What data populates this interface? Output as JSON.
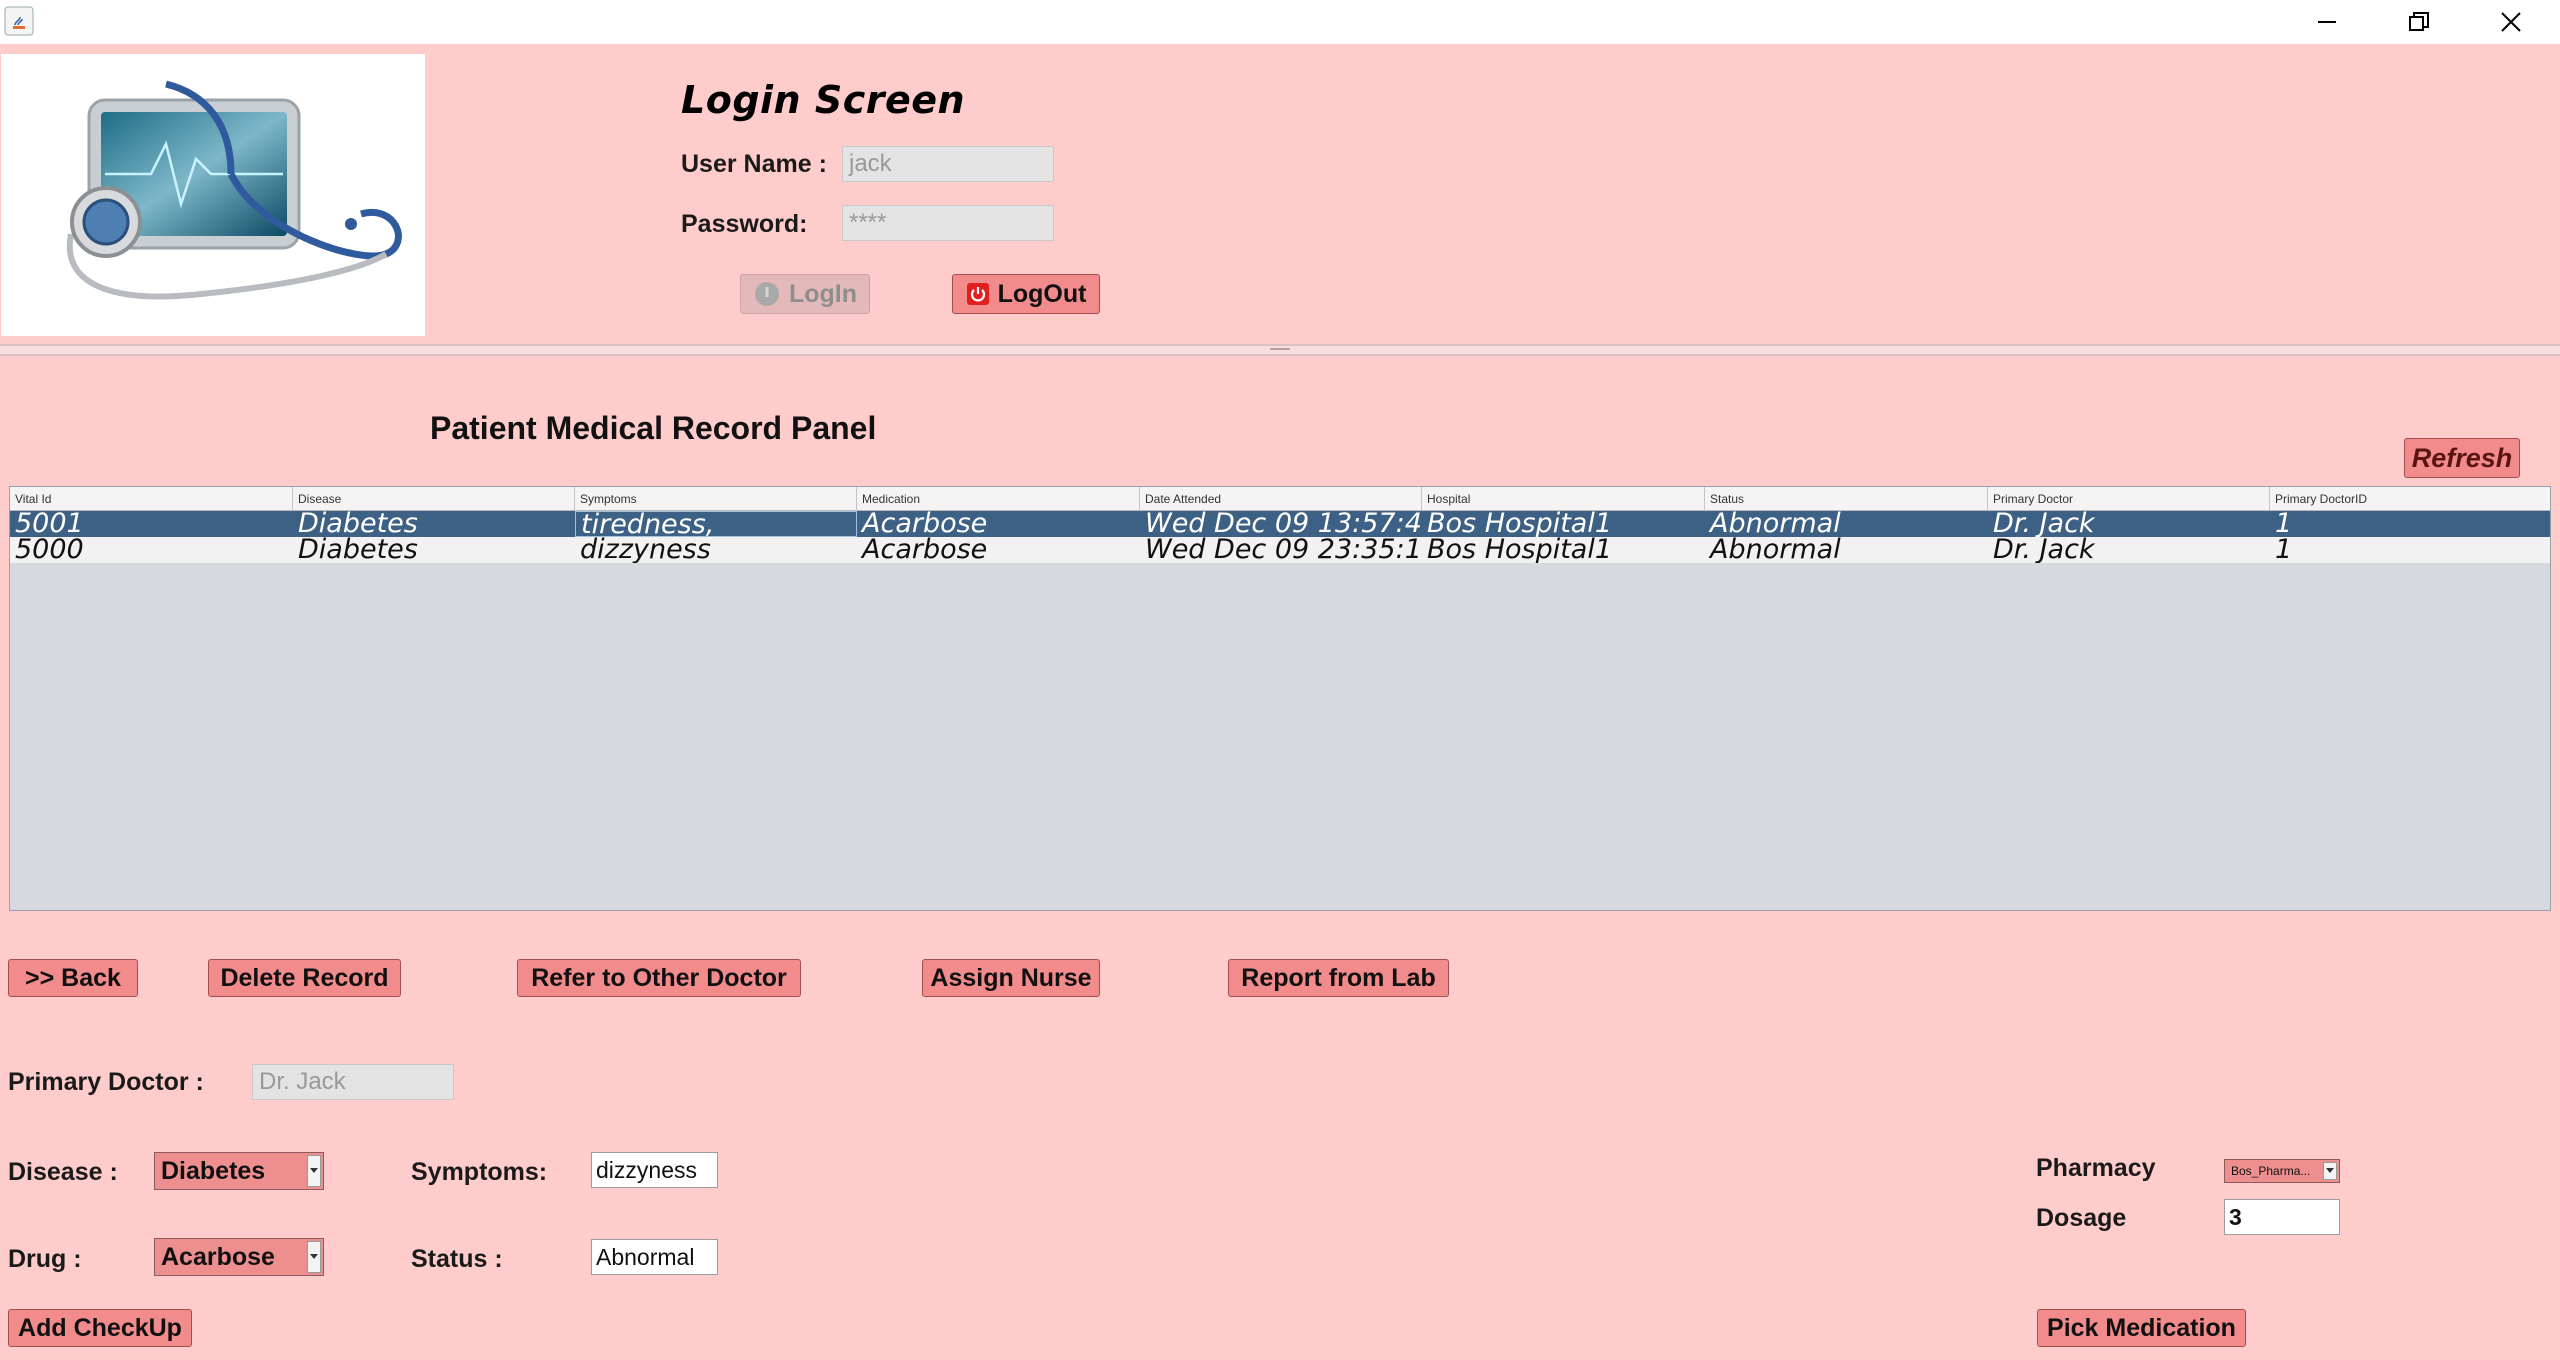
{
  "window": {
    "minimize_icon": "minimize-icon",
    "restore_icon": "restore-icon",
    "close_icon": "close-icon"
  },
  "login": {
    "title": "Login Screen",
    "username_label": "User Name :",
    "username_value": "jack",
    "password_label": "Password:",
    "password_value": "****",
    "login_button": "LogIn",
    "logout_button": "LogOut"
  },
  "panel": {
    "title": "Patient Medical Record Panel",
    "refresh_button": "Refresh"
  },
  "table": {
    "columns": [
      "Vital Id",
      "Disease",
      "Symptoms",
      "Medication",
      "Date Attended",
      "Hospital",
      "Status",
      "Primary Doctor",
      "Primary DoctorID"
    ],
    "rows": [
      [
        "5001",
        "Diabetes",
        "tiredness,",
        "Acarbose",
        "Wed Dec 09 13:57:4...",
        "Bos  Hospital1",
        "Abnormal",
        "Dr. Jack",
        "1"
      ],
      [
        "5000",
        "Diabetes",
        "dizzyness",
        "Acarbose",
        "Wed Dec 09 23:35:1...",
        "Bos  Hospital1",
        "Abnormal",
        "Dr. Jack",
        "1"
      ]
    ]
  },
  "actions": {
    "back": ">> Back",
    "delete": "Delete Record",
    "refer": "Refer to Other Doctor",
    "assign_nurse": "Assign Nurse",
    "report_lab": "Report from Lab"
  },
  "form": {
    "primary_doctor_label": "Primary Doctor :",
    "primary_doctor_value": "Dr. Jack",
    "disease_label": "Disease :",
    "disease_value": "Diabetes",
    "symptoms_label": "Symptoms:",
    "symptoms_value": "dizzyness",
    "drug_label": "Drug :",
    "drug_value": "Acarbose",
    "status_label": "Status :",
    "status_value": "Abnormal",
    "add_checkup": "Add CheckUp",
    "pharmacy_label": "Pharmacy",
    "pharmacy_value": "Bos_Pharma...",
    "dosage_label": "Dosage",
    "dosage_value": "3",
    "pick_medication": "Pick Medication"
  },
  "colors": {
    "background": "#ffcccc",
    "button": "#f28b8b",
    "selected_row": "#3d6185",
    "table_bg": "#d6d9e0"
  }
}
